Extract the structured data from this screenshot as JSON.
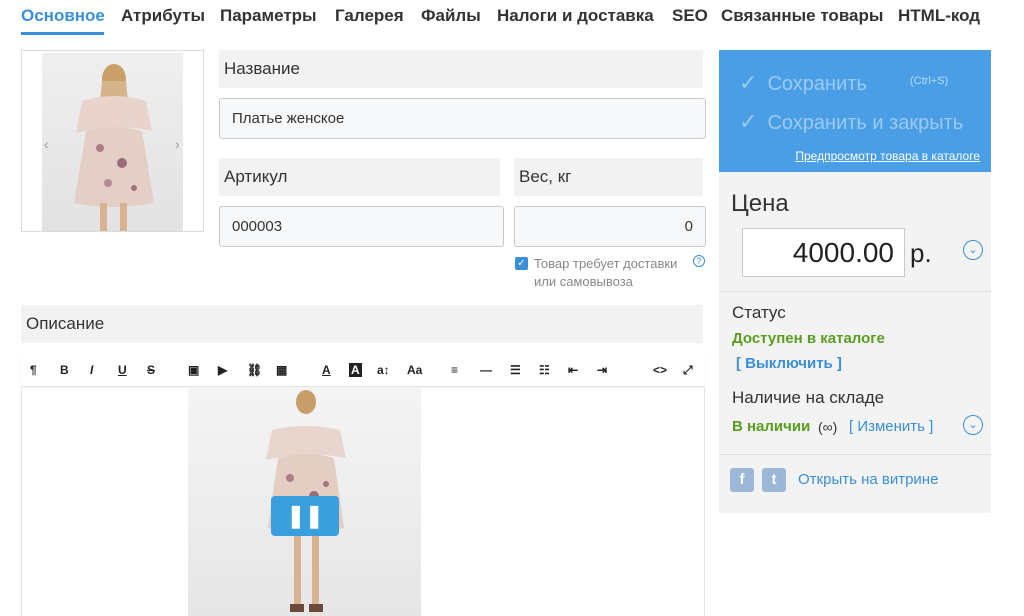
{
  "tabs": [
    {
      "label": "Основное",
      "active": true
    },
    {
      "label": "Атрибуты"
    },
    {
      "label": "Параметры"
    },
    {
      "label": "Галерея"
    },
    {
      "label": "Файлы"
    },
    {
      "label": "Налоги и доставка"
    },
    {
      "label": "SEO"
    },
    {
      "label": "Связанные товары"
    },
    {
      "label": "HTML-код"
    }
  ],
  "gallery": {
    "prev": "‹",
    "next": "›"
  },
  "fields": {
    "name_label": "Название",
    "name_value": "Платье женское",
    "sku_label": "Артикул",
    "sku_value": "000003",
    "weight_label": "Вес, кг",
    "weight_value": "0",
    "shipping_checkbox_label": "Товар требует доставки или самовывоза",
    "shipping_checked": true,
    "help_glyph": "?",
    "description_label": "Описание"
  },
  "editor": {
    "toolbar": [
      "¶",
      "B",
      "I",
      "U",
      "S",
      "▣",
      "▶",
      "⛓",
      "▦",
      "A",
      "A",
      "a↕",
      "Aa",
      "≡",
      "—",
      "☰",
      "☷",
      "⇤",
      "⇥",
      "<>",
      "⤢"
    ]
  },
  "save": {
    "save_label": "Сохранить",
    "shortcut": "(Ctrl+S)",
    "save_close_label": "Сохранить и закрыть",
    "preview_link": "Предпросмотр товара в каталоге"
  },
  "price": {
    "label": "Цена",
    "value": "4000.00",
    "currency": "р."
  },
  "status": {
    "label": "Статус",
    "value": "Доступен в каталоге",
    "action": "[ Выключить ]"
  },
  "stock": {
    "label": "Наличие на складе",
    "value": "В наличии",
    "infinity": "(∞)",
    "action": "[ Изменить ]"
  },
  "social": {
    "facebook": "f",
    "twitter": "t"
  },
  "open_storefront": "Открыть на витрине",
  "colors": {
    "accent": "#3a8fd9",
    "save_panel": "#4a9ee6",
    "status_green": "#5a9e20"
  }
}
